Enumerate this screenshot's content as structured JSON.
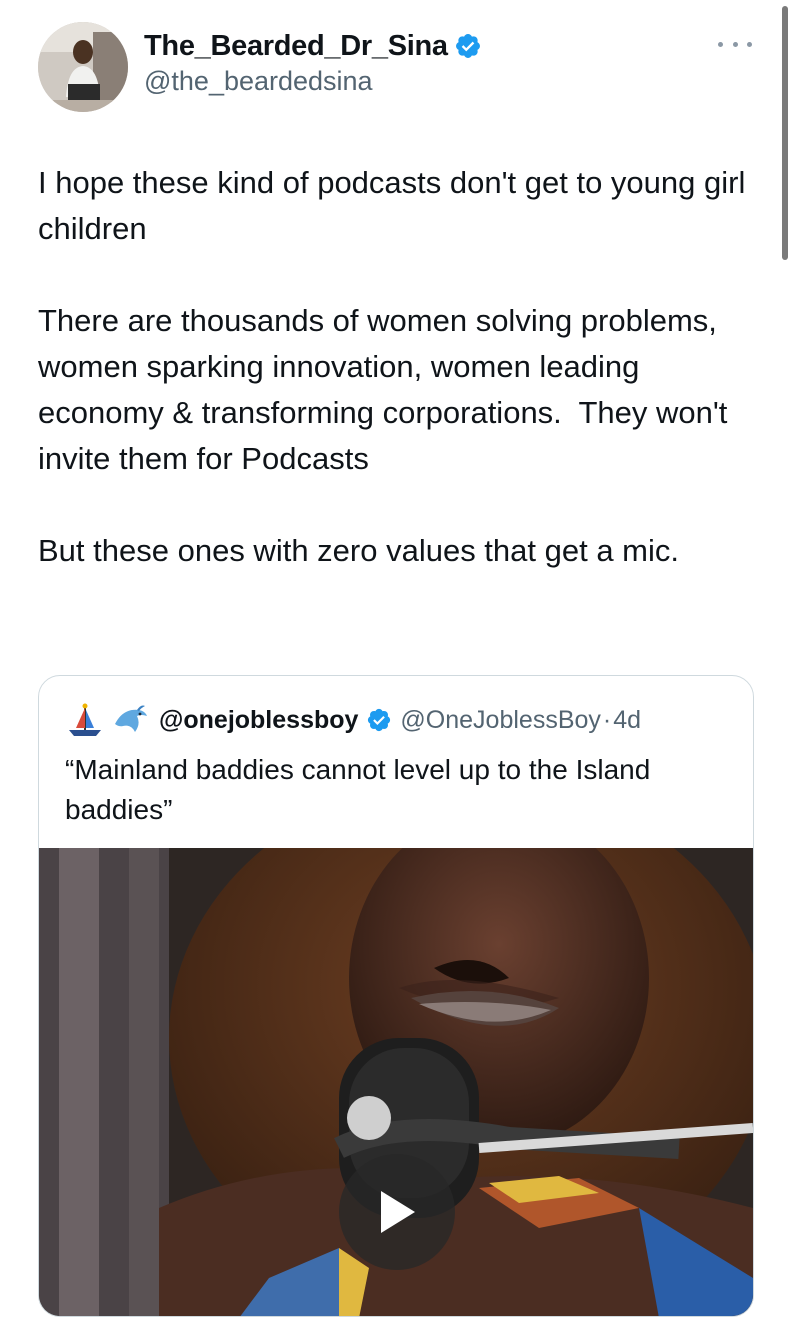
{
  "author": {
    "display_name": "The_Bearded_Dr_Sina",
    "handle": "@the_beardedsina",
    "verified": true,
    "avatar_icon": "profile-photo"
  },
  "tweet": {
    "paragraphs": [
      "I hope these kind of podcasts don't get to young girl children",
      "There are thousands of women solving problems, women sparking innovation, women leading economy & transforming corporations.  They won't invite them for Podcasts",
      "But these ones with zero values that get a mic."
    ]
  },
  "quoted_tweet": {
    "display_name": "@onejoblessboy",
    "handle": "@OneJoblessBoy",
    "separator": "·",
    "time": "4d",
    "verified": true,
    "text": "“Mainland baddies cannot level up to the Island baddies”",
    "media": {
      "type": "video",
      "play_icon": "play-icon"
    }
  },
  "colors": {
    "text_primary": "#0f1419",
    "text_secondary": "#536471",
    "verified_blue": "#1d9bf0",
    "border": "#cfd9de"
  }
}
